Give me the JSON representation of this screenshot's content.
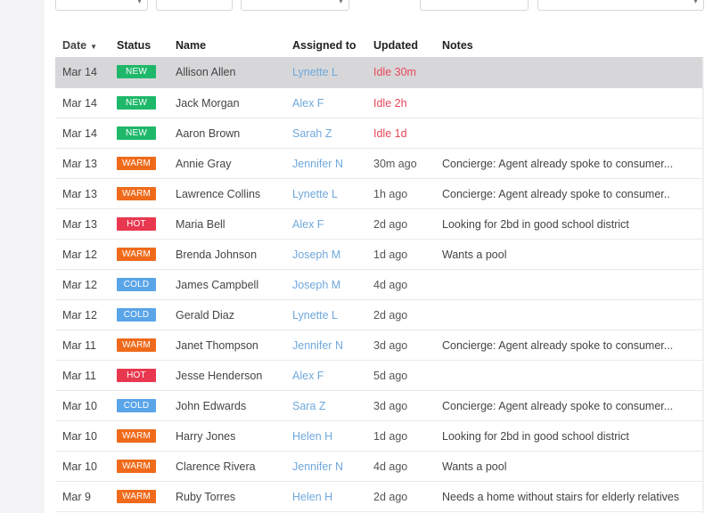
{
  "colors": {
    "new": "#1fb86b",
    "warm": "#ef6a1a",
    "hot": "#e8384f",
    "cold": "#5aa4e8",
    "link": "#6fa8dc",
    "idle": "#e8485b"
  },
  "headers": {
    "date": "Date",
    "status": "Status",
    "name": "Name",
    "assigned": "Assigned to",
    "updated": "Updated",
    "notes": "Notes"
  },
  "rows": [
    {
      "date": "Mar 14",
      "status": "NEW",
      "name": "Allison Allen",
      "assigned": "Lynette L",
      "updated": "Idle 30m",
      "notes": ""
    },
    {
      "date": "Mar 14",
      "status": "NEW",
      "name": "Jack Morgan",
      "assigned": "Alex F",
      "updated": "Idle 2h",
      "notes": ""
    },
    {
      "date": "Mar 14",
      "status": "NEW",
      "name": "Aaron Brown",
      "assigned": "Sarah Z",
      "updated": "Idle 1d",
      "notes": ""
    },
    {
      "date": "Mar 13",
      "status": "WARM",
      "name": "Annie Gray",
      "assigned": "Jennifer N",
      "updated": "30m ago",
      "notes": "Concierge: Agent already spoke to consumer..."
    },
    {
      "date": "Mar 13",
      "status": "WARM",
      "name": "Lawrence Collins",
      "assigned": "Lynette L",
      "updated": "1h ago",
      "notes": "Concierge: Agent already spoke to consumer.."
    },
    {
      "date": "Mar 13",
      "status": "HOT",
      "name": "Maria Bell",
      "assigned": "Alex F",
      "updated": "2d ago",
      "notes": "Looking for 2bd in good school district"
    },
    {
      "date": "Mar 12",
      "status": "WARM",
      "name": "Brenda Johnson",
      "assigned": "Joseph M",
      "updated": "1d ago",
      "notes": "Wants a pool"
    },
    {
      "date": "Mar 12",
      "status": "COLD",
      "name": "James Campbell",
      "assigned": "Joseph M",
      "updated": "4d ago",
      "notes": ""
    },
    {
      "date": "Mar 12",
      "status": "COLD",
      "name": "Gerald Diaz",
      "assigned": "Lynette L",
      "updated": "2d ago",
      "notes": ""
    },
    {
      "date": "Mar 11",
      "status": "WARM",
      "name": "Janet Thompson",
      "assigned": "Jennifer N",
      "updated": "3d ago",
      "notes": "Concierge: Agent already spoke to consumer..."
    },
    {
      "date": "Mar 11",
      "status": "HOT",
      "name": "Jesse Henderson",
      "assigned": "Alex F",
      "updated": "5d ago",
      "notes": ""
    },
    {
      "date": "Mar 10",
      "status": "COLD",
      "name": "John Edwards",
      "assigned": "Sara Z",
      "updated": "3d ago",
      "notes": "Concierge: Agent already spoke to consumer..."
    },
    {
      "date": "Mar 10",
      "status": "WARM",
      "name": "Harry Jones",
      "assigned": "Helen H",
      "updated": "1d ago",
      "notes": "Looking for 2bd in good school district"
    },
    {
      "date": "Mar 10",
      "status": "WARM",
      "name": "Clarence Rivera",
      "assigned": "Jennifer N",
      "updated": "4d ago",
      "notes": "Wants a pool"
    },
    {
      "date": "Mar 9",
      "status": "WARM",
      "name": "Ruby Torres",
      "assigned": "Helen H",
      "updated": "2d ago",
      "notes": "Needs a home without stairs for elderly relatives"
    }
  ]
}
